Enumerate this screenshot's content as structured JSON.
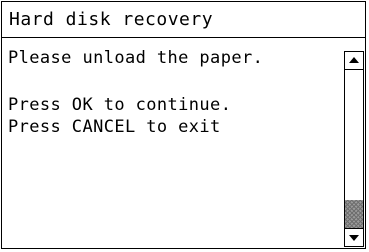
{
  "dialog": {
    "title": "Hard disk recovery",
    "lines": [
      "Please unload the paper.",
      "Press OK to continue.",
      "Press CANCEL to exit"
    ]
  },
  "scrollbar": {
    "up_icon": "arrow-up-icon",
    "down_icon": "arrow-down-icon",
    "thumb_start_fraction": 0.82,
    "thumb_end_fraction": 1.0
  }
}
